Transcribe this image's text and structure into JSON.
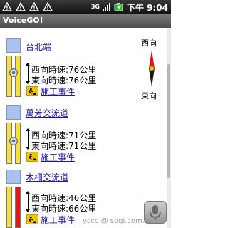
{
  "status_bar": {
    "time": "下午 9:04",
    "network": "3G"
  },
  "app": {
    "title": "VoiceGO!"
  },
  "compass": {
    "west": "西向",
    "east": "東向"
  },
  "stations": [
    {
      "name": "台北端",
      "west_speed": "西向時速:76公里",
      "east_speed": "東向時速:76公里",
      "event": "施工事件"
    },
    {
      "name": "萬芳交流道",
      "west_speed": "西向時速:71公里",
      "east_speed": "東向時速:71公里",
      "event": "施工事件"
    },
    {
      "name": "木柵交流道",
      "west_speed": "西向時速:46公里",
      "east_speed": "東向時速:66公里",
      "event": "施工事件"
    }
  ],
  "watermark": "yccc @ sogi.com.tw",
  "colors": {
    "lane_yellow": "#f5e13a",
    "lane_red": "#e01818",
    "station_blue": "#a9c2ee",
    "link_blue": "#1a1aa6"
  }
}
